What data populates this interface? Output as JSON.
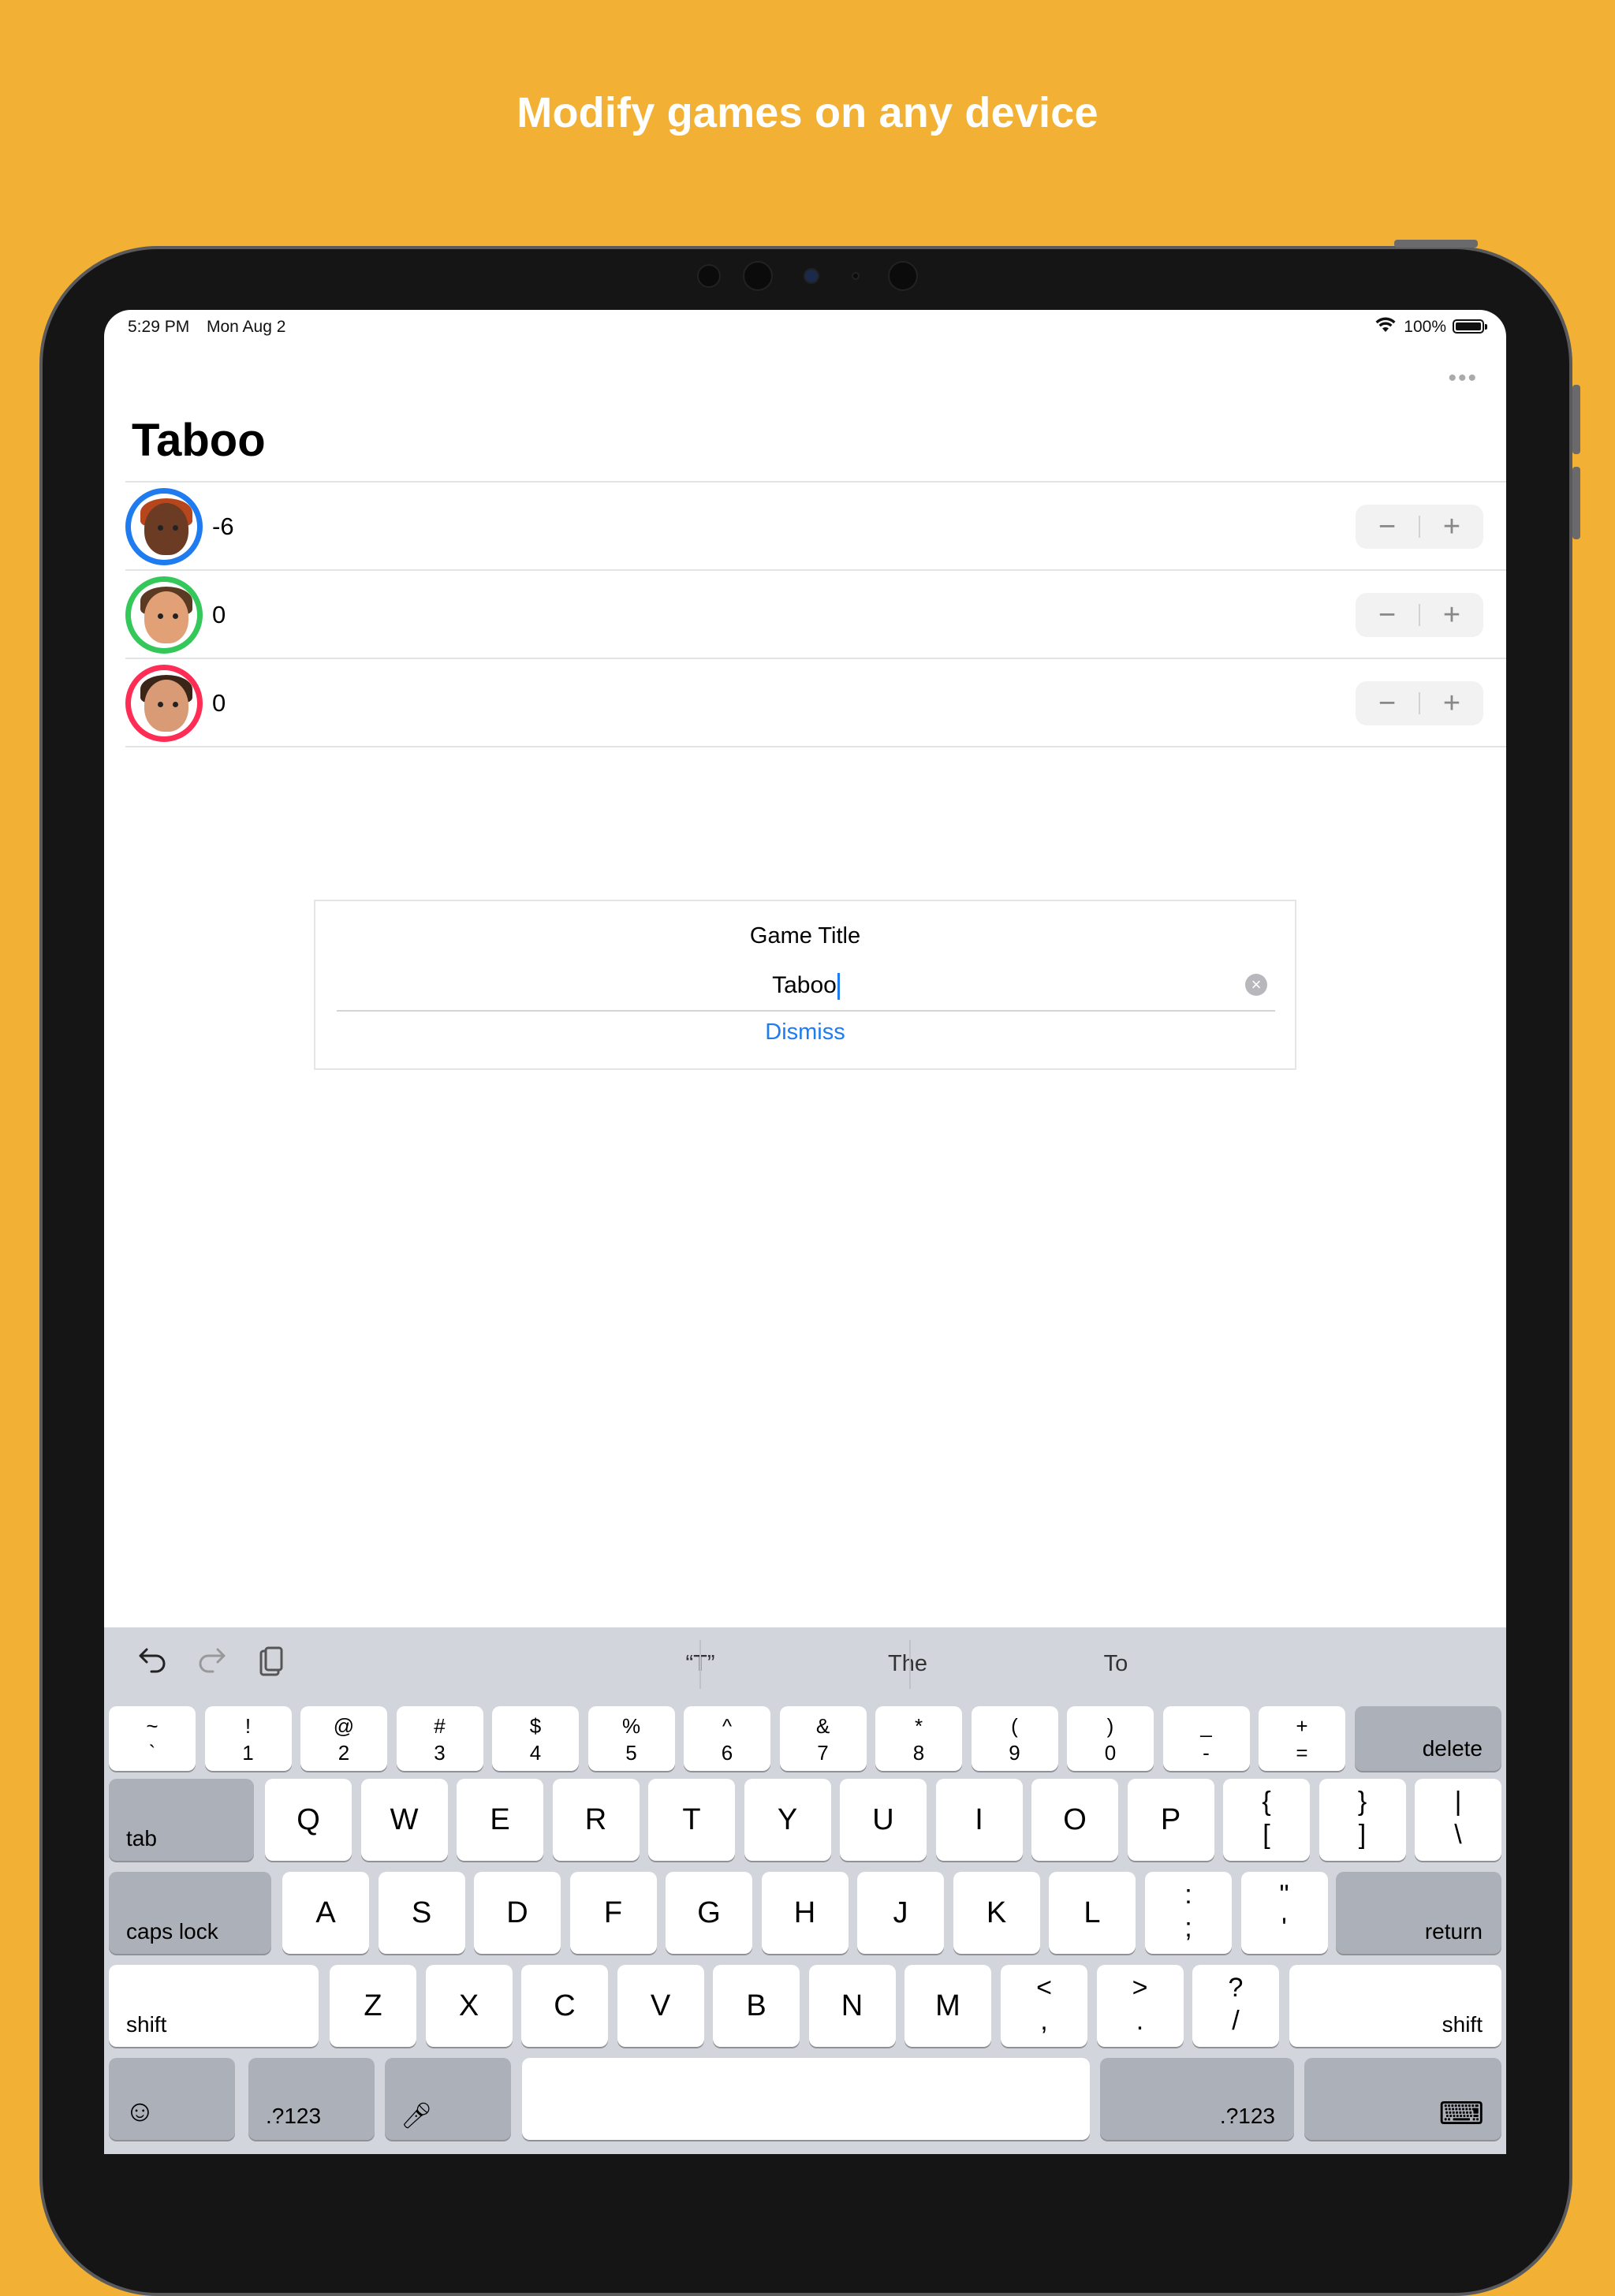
{
  "headline": "Modify games on any device",
  "status_bar": {
    "time": "5:29 PM",
    "date": "Mon Aug 2",
    "battery": "100%"
  },
  "icons": {
    "more": "more-horizontal-icon",
    "wifi": "wifi-icon",
    "battery": "battery-icon"
  },
  "game": {
    "title": "Taboo",
    "players": [
      {
        "score": "-6",
        "ring_color": "#1E7BF0",
        "skin": "#6b3b24",
        "hair": "#b8461c"
      },
      {
        "score": "0",
        "ring_color": "#34C759",
        "skin": "#e2a077",
        "hair": "#5a3a22"
      },
      {
        "score": "0",
        "ring_color": "#FF2D55",
        "skin": "#d99a76",
        "hair": "#3b2418"
      }
    ],
    "stepper": {
      "minus": "−",
      "plus": "+"
    }
  },
  "dialog": {
    "title": "Game Title",
    "input_value": "Taboo",
    "dismiss": "Dismiss"
  },
  "keyboard": {
    "suggestions": [
      "“T”",
      "The",
      "To"
    ],
    "number_row": [
      [
        "~",
        "`"
      ],
      [
        "!",
        "1"
      ],
      [
        "@",
        "2"
      ],
      [
        "#",
        "3"
      ],
      [
        "$",
        "4"
      ],
      [
        "%",
        "5"
      ],
      [
        "^",
        "6"
      ],
      [
        "&",
        "7"
      ],
      [
        "*",
        "8"
      ],
      [
        "(",
        "9"
      ],
      [
        ")",
        "0"
      ],
      [
        "_",
        "-"
      ],
      [
        "+",
        "="
      ]
    ],
    "row1": [
      "Q",
      "W",
      "E",
      "R",
      "T",
      "Y",
      "U",
      "I",
      "O",
      "P"
    ],
    "row1_syms": [
      [
        "{",
        "["
      ],
      [
        "}",
        "]"
      ],
      [
        "|",
        "\\"
      ]
    ],
    "row2": [
      "A",
      "S",
      "D",
      "F",
      "G",
      "H",
      "J",
      "K",
      "L"
    ],
    "row2_syms": [
      [
        ":",
        ";"
      ],
      [
        "\"",
        "'"
      ]
    ],
    "row3": [
      "Z",
      "X",
      "C",
      "V",
      "B",
      "N",
      "M"
    ],
    "row3_syms": [
      [
        "<",
        ","
      ],
      [
        ">",
        "."
      ],
      [
        "?",
        "/"
      ]
    ],
    "labels": {
      "delete": "delete",
      "tab": "tab",
      "caps_lock": "caps lock",
      "return": "return",
      "shift": "shift",
      "numbers": ".?123",
      "emoji": "☺",
      "mic": "🎤︎",
      "hide": "⌨"
    }
  }
}
